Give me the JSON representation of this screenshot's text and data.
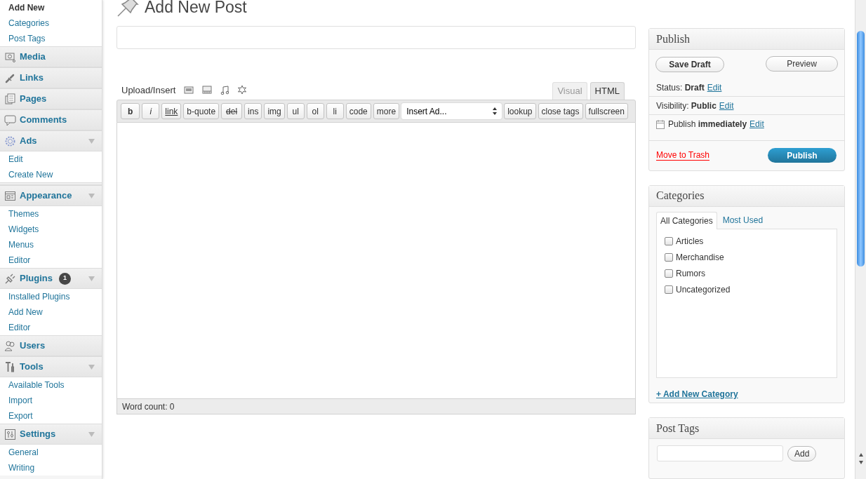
{
  "sidebar": {
    "items": [
      {
        "kind": "sub",
        "label": "Add New",
        "selected": true
      },
      {
        "kind": "sub",
        "label": "Categories",
        "selected": false
      },
      {
        "kind": "sub",
        "label": "Post Tags",
        "selected": false
      },
      {
        "kind": "menu",
        "label": "Media",
        "expanded": false
      },
      {
        "kind": "menu",
        "label": "Links",
        "expanded": false
      },
      {
        "kind": "menu",
        "label": "Pages",
        "expanded": false
      },
      {
        "kind": "menu",
        "label": "Comments",
        "expanded": false
      },
      {
        "kind": "menu",
        "label": "Ads",
        "expanded": true
      },
      {
        "kind": "sub",
        "label": "Edit",
        "selected": false
      },
      {
        "kind": "sub",
        "label": "Create New",
        "selected": false
      },
      {
        "kind": "separator"
      },
      {
        "kind": "menu",
        "label": "Appearance",
        "expanded": true
      },
      {
        "kind": "sub",
        "label": "Themes",
        "selected": false
      },
      {
        "kind": "sub",
        "label": "Widgets",
        "selected": false
      },
      {
        "kind": "sub",
        "label": "Menus",
        "selected": false
      },
      {
        "kind": "sub",
        "label": "Editor",
        "selected": false
      },
      {
        "kind": "menu",
        "label": "Plugins",
        "expanded": true,
        "badge": "1"
      },
      {
        "kind": "sub",
        "label": "Installed Plugins",
        "selected": false
      },
      {
        "kind": "sub",
        "label": "Add New",
        "selected": false
      },
      {
        "kind": "sub",
        "label": "Editor",
        "selected": false
      },
      {
        "kind": "menu",
        "label": "Users",
        "expanded": false
      },
      {
        "kind": "menu",
        "label": "Tools",
        "expanded": true
      },
      {
        "kind": "sub",
        "label": "Available Tools",
        "selected": false
      },
      {
        "kind": "sub",
        "label": "Import",
        "selected": false
      },
      {
        "kind": "sub",
        "label": "Export",
        "selected": false
      },
      {
        "kind": "menu",
        "label": "Settings",
        "expanded": true
      },
      {
        "kind": "sub",
        "label": "General",
        "selected": false
      },
      {
        "kind": "sub",
        "label": "Writing",
        "selected": false
      }
    ]
  },
  "page_title": "Add New Post",
  "upload_label": "Upload/Insert",
  "editor_tabs": [
    {
      "label": "Visual",
      "selected": false
    },
    {
      "label": "HTML",
      "selected": true
    }
  ],
  "toolbar": [
    {
      "kind": "bold",
      "label": "b"
    },
    {
      "kind": "italic",
      "label": "i"
    },
    {
      "kind": "link",
      "label": "link"
    },
    {
      "kind": "plain",
      "label": "b-quote"
    },
    {
      "kind": "strike",
      "label": "del"
    },
    {
      "kind": "plain",
      "label": "ins"
    },
    {
      "kind": "plain",
      "label": "img"
    },
    {
      "kind": "plain",
      "label": "ul"
    },
    {
      "kind": "plain",
      "label": "ol"
    },
    {
      "kind": "plain",
      "label": "li"
    },
    {
      "kind": "plain",
      "label": "code"
    },
    {
      "kind": "plain",
      "label": "more"
    },
    {
      "kind": "select",
      "label": "Insert Ad..."
    },
    {
      "kind": "plain",
      "label": "lookup"
    },
    {
      "kind": "plain",
      "label": "close tags"
    },
    {
      "kind": "plain",
      "label": "fullscreen"
    }
  ],
  "word_count": "Word count: 0",
  "publish": {
    "title": "Publish",
    "save_draft": "Save Draft",
    "preview": "Preview",
    "rows": [
      {
        "text": "Status: **Draft**",
        "link": "Edit",
        "calendar": false
      },
      {
        "text": "Visibility: **Public**",
        "link": "Edit",
        "calendar": false
      },
      {
        "text": "Publish **immediately**",
        "link": "Edit",
        "calendar": true
      }
    ],
    "trash": "Move to Trash",
    "publish_button": "Publish"
  },
  "categories": {
    "title": "Categories",
    "tabs": [
      {
        "label": "All Categories",
        "selected": true
      },
      {
        "label": "Most Used",
        "selected": false
      }
    ],
    "items": [
      {
        "label": "Articles",
        "checked": false
      },
      {
        "label": "Merchandise",
        "checked": false
      },
      {
        "label": "Rumors",
        "checked": false
      },
      {
        "label": "Uncategorized",
        "checked": false
      }
    ],
    "add_link": "+ Add New Category"
  },
  "post_tags": {
    "title": "Post Tags",
    "add_button": "Add"
  }
}
